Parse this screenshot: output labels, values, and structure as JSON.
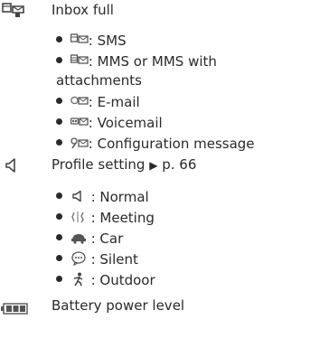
{
  "inbox": {
    "title": "Inbox full",
    "icon": "inbox-full-icon",
    "items": [
      {
        "icon": "sms-icon",
        "sep": ":",
        "label": "SMS"
      },
      {
        "icon": "mms-icon",
        "sep": ":",
        "label": "MMS or MMS with",
        "label_cont": "attachments"
      },
      {
        "icon": "email-icon",
        "sep": ":",
        "label": "E-mail"
      },
      {
        "icon": "voicemail-icon",
        "sep": ":",
        "label": "Voicemail"
      },
      {
        "icon": "configuration-icon",
        "sep": ":",
        "label": "Configuration message"
      }
    ]
  },
  "profile": {
    "title": "Profile setting",
    "arrow": "▶",
    "page_ref": "p. 66",
    "icon": "speaker-icon",
    "items": [
      {
        "icon": "speaker-icon",
        "sep": ":",
        "label": "Normal"
      },
      {
        "icon": "meeting-icon",
        "sep": ":",
        "label": "Meeting"
      },
      {
        "icon": "car-icon",
        "sep": ":",
        "label": "Car"
      },
      {
        "icon": "silent-icon",
        "sep": ":",
        "label": "Silent"
      },
      {
        "icon": "outdoor-icon",
        "sep": ":",
        "label": "Outdoor"
      }
    ]
  },
  "battery": {
    "title": "Battery power level",
    "icon": "battery-icon"
  }
}
